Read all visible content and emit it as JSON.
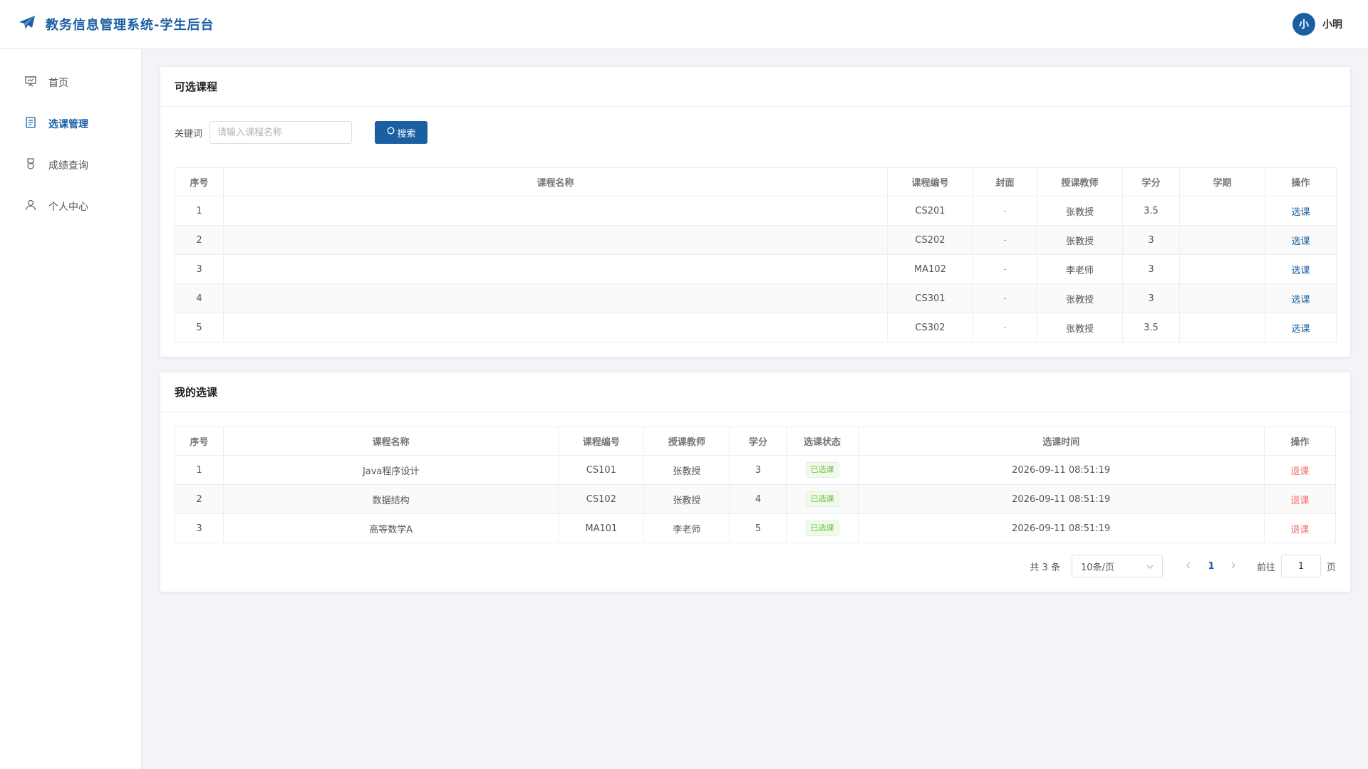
{
  "header": {
    "title": "教务信息管理系统-学生后台",
    "avatar_text": "小",
    "user_name": "小明"
  },
  "sidebar": {
    "items": [
      {
        "label": "首页",
        "icon": "presentation-icon"
      },
      {
        "label": "选课管理",
        "icon": "document-icon"
      },
      {
        "label": "成绩查询",
        "icon": "medal-icon"
      },
      {
        "label": "个人中心",
        "icon": "user-icon"
      }
    ],
    "active_index": 1
  },
  "available": {
    "title": "可选课程",
    "search_label": "关键词",
    "search_placeholder": "请输入课程名称",
    "search_button": "搜索",
    "columns": [
      "序号",
      "课程名称",
      "课程编号",
      "封面",
      "授课教师",
      "学分",
      "学期",
      "操作"
    ],
    "rows": [
      {
        "no": "1",
        "name": "",
        "code": "CS201",
        "cover": "-",
        "teacher": "张教授",
        "credit": "3.5",
        "term": "",
        "action": "选课"
      },
      {
        "no": "2",
        "name": "",
        "code": "CS202",
        "cover": "-",
        "teacher": "张教授",
        "credit": "3",
        "term": "",
        "action": "选课"
      },
      {
        "no": "3",
        "name": "",
        "code": "MA102",
        "cover": "-",
        "teacher": "李老师",
        "credit": "3",
        "term": "",
        "action": "选课"
      },
      {
        "no": "4",
        "name": "",
        "code": "CS301",
        "cover": "-",
        "teacher": "张教授",
        "credit": "3",
        "term": "",
        "action": "选课"
      },
      {
        "no": "5",
        "name": "",
        "code": "CS302",
        "cover": "-",
        "teacher": "张教授",
        "credit": "3.5",
        "term": "",
        "action": "选课"
      }
    ]
  },
  "mine": {
    "title": "我的选课",
    "columns": [
      "序号",
      "课程名称",
      "课程编号",
      "授课教师",
      "学分",
      "选课状态",
      "选课时间",
      "操作"
    ],
    "rows": [
      {
        "no": "1",
        "name": "Java程序设计",
        "code": "CS101",
        "teacher": "张教授",
        "credit": "3",
        "status": "已选课",
        "time": "2026-09-11 08:51:19",
        "action": "退课"
      },
      {
        "no": "2",
        "name": "数据结构",
        "code": "CS102",
        "teacher": "张教授",
        "credit": "4",
        "status": "已选课",
        "time": "2026-09-11 08:51:19",
        "action": "退课"
      },
      {
        "no": "3",
        "name": "高等数学A",
        "code": "MA101",
        "teacher": "李老师",
        "credit": "5",
        "status": "已选课",
        "time": "2026-09-11 08:51:19",
        "action": "退课"
      }
    ]
  },
  "pager": {
    "total": "共 3 条",
    "page_size": "10条/页",
    "current_page": "1",
    "goto_label": "前往",
    "goto_value": "1",
    "goto_unit": "页"
  },
  "colors": {
    "primary": "#1b5fa3",
    "danger": "#f56c6c",
    "success": "#67c23a"
  }
}
